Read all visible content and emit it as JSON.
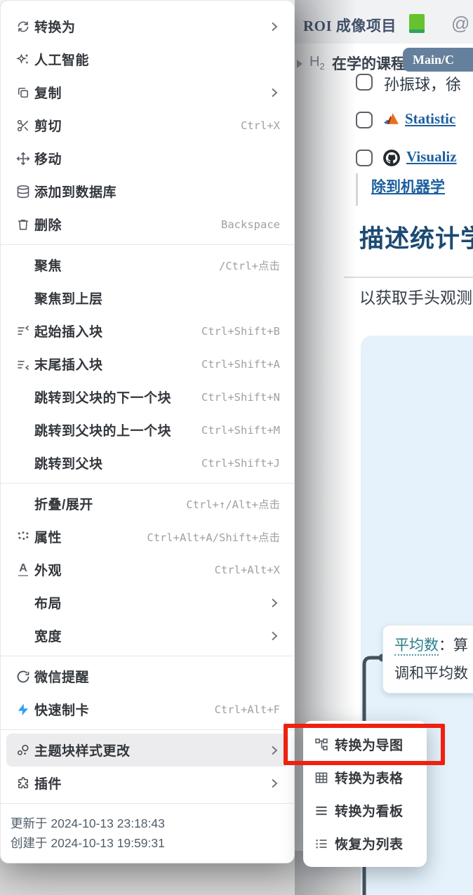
{
  "menu": {
    "items": [
      {
        "label": "转换为",
        "chevron": true
      },
      {
        "label": "人工智能"
      },
      {
        "label": "复制",
        "chevron": true
      },
      {
        "label": "剪切",
        "shortcut": "Ctrl+X"
      },
      {
        "label": "移动"
      },
      {
        "label": "添加到数据库"
      },
      {
        "label": "删除",
        "shortcut": "Backspace"
      },
      {
        "divider": true
      },
      {
        "label": "聚焦",
        "shortcut": "/Ctrl+点击"
      },
      {
        "label": "聚焦到上层"
      },
      {
        "label": "起始插入块",
        "shortcut": "Ctrl+Shift+B"
      },
      {
        "label": "末尾插入块",
        "shortcut": "Ctrl+Shift+A"
      },
      {
        "label": "跳转到父块的下一个块",
        "shortcut": "Ctrl+Shift+N"
      },
      {
        "label": "跳转到父块的上一个块",
        "shortcut": "Ctrl+Shift+M"
      },
      {
        "label": "跳转到父块",
        "shortcut": "Ctrl+Shift+J"
      },
      {
        "divider": true
      },
      {
        "label": "折叠/展开",
        "shortcut": "Ctrl+↑/Alt+点击"
      },
      {
        "label": "属性",
        "shortcut": "Ctrl+Alt+A/Shift+点击"
      },
      {
        "label": "外观",
        "shortcut": "Ctrl+Alt+X"
      },
      {
        "label": "布局",
        "chevron": true
      },
      {
        "label": "宽度",
        "chevron": true
      },
      {
        "divider": true
      },
      {
        "label": "微信提醒"
      },
      {
        "label": "快速制卡",
        "shortcut": "Ctrl+Alt+F"
      },
      {
        "divider": true
      },
      {
        "label": "主题块样式更改",
        "chevron": true,
        "hovered": true
      },
      {
        "label": "插件",
        "chevron": true
      },
      {
        "divider": true
      }
    ],
    "footer": {
      "updated": "更新于 2024-10-13 23:18:43",
      "created": "创建于 2024-10-13 19:59:31"
    }
  },
  "submenu": {
    "items": [
      {
        "label": "转换为导图",
        "highlighted": true
      },
      {
        "label": "转换为表格"
      },
      {
        "label": "转换为看板"
      },
      {
        "label": "恢复为列表"
      }
    ]
  },
  "document": {
    "title": "ROI 成像项目",
    "mention": "@",
    "h_tag_letter": "H",
    "h_tag_sub": "2",
    "section_title": "在学的课程",
    "badge": "Main/C",
    "tasks": {
      "t0": "孙振球，徐",
      "t1": "Statistic",
      "t2": "Visualiz",
      "t3": "除到机器学"
    },
    "heading": "描述统计学",
    "paragraph": "以获取手头观测",
    "mindmap_node": {
      "term": "平均数",
      "rest": "：算",
      "line2": "调和平均数"
    }
  },
  "icons": {
    "appearance": "A"
  },
  "colors": {
    "accent_red": "#ee2110",
    "link_blue": "#1c5f9e",
    "heading_navy": "#1c4a72",
    "badge_blue": "#64809c",
    "canvas_blue": "#e5f2fb",
    "term_teal": "#2b7e8b",
    "flash_blue": "#2aa1f1",
    "book_green": "#66c22d"
  }
}
